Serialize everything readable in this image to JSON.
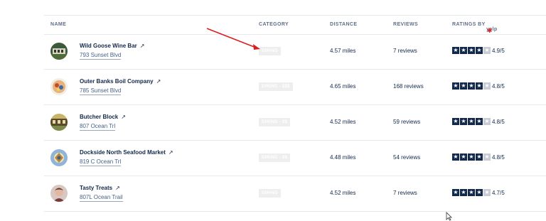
{
  "header": {
    "name": "NAME",
    "category": "CATEGORY",
    "distance": "DISTANCE",
    "reviews": "REVIEWS",
    "ratings_by": "RATINGS BY",
    "ratings_source": "yelp"
  },
  "rows": [
    {
      "name": "Wild Goose Wine Bar",
      "address": "793 Sunset Blvd",
      "category": "DINING",
      "distance": "4.57 miles",
      "reviews": "7 reviews",
      "stars": 4,
      "rating": "4.9/5"
    },
    {
      "name": "Outer Banks Boil Company",
      "address": "785 Sunset Blvd",
      "category": "DINING - $$$",
      "distance": "4.65 miles",
      "reviews": "168 reviews",
      "stars": 4,
      "rating": "4.8/5"
    },
    {
      "name": "Butcher Block",
      "address": "807 Ocean Trl",
      "category": "DINING - $$",
      "distance": "4.52 miles",
      "reviews": "59 reviews",
      "stars": 4,
      "rating": "4.8/5"
    },
    {
      "name": "Dockside North Seafood Market",
      "address": "819 C Ocean Trl",
      "category": "DINING - $$",
      "distance": "4.48 miles",
      "reviews": "54 reviews",
      "stars": 4,
      "rating": "4.8/5"
    },
    {
      "name": "Tasty Treats",
      "address": "807L Ocean Trail",
      "category": "DINING",
      "distance": "4.52 miles",
      "reviews": "7 reviews",
      "stars": 4,
      "rating": "4.7/5"
    }
  ],
  "colors": {
    "text": "#13294b",
    "star": "#13294b",
    "star_off": "#c9cdd3",
    "badge_bg": "#eeeeee",
    "annotation_arrow": "#d62020",
    "yelp_burst": "#d32323"
  },
  "icons": {
    "external_link": "external-link-icon",
    "star": "star-icon",
    "yelp_burst": "yelp-burst-icon"
  }
}
